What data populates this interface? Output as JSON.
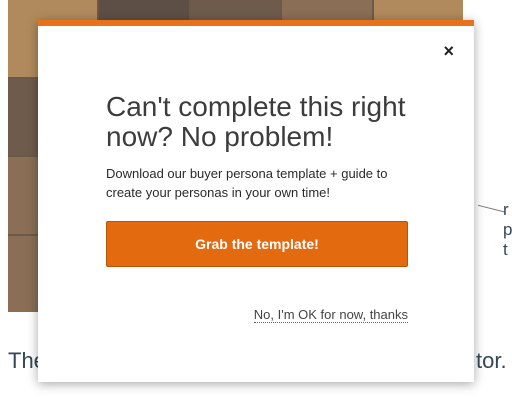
{
  "background": {
    "text_left": "The",
    "text_right": "tor.",
    "side_letters": [
      "r",
      "p",
      "t"
    ]
  },
  "modal": {
    "headline": "Can't complete this right now? No problem!",
    "subtext": "Download our buyer persona template + guide to create your personas in  your own time!",
    "cta_label": "Grab the template!",
    "decline_label": "No, I'm OK for now, thanks",
    "close_label": "×",
    "accent_color": "#e8711a"
  }
}
